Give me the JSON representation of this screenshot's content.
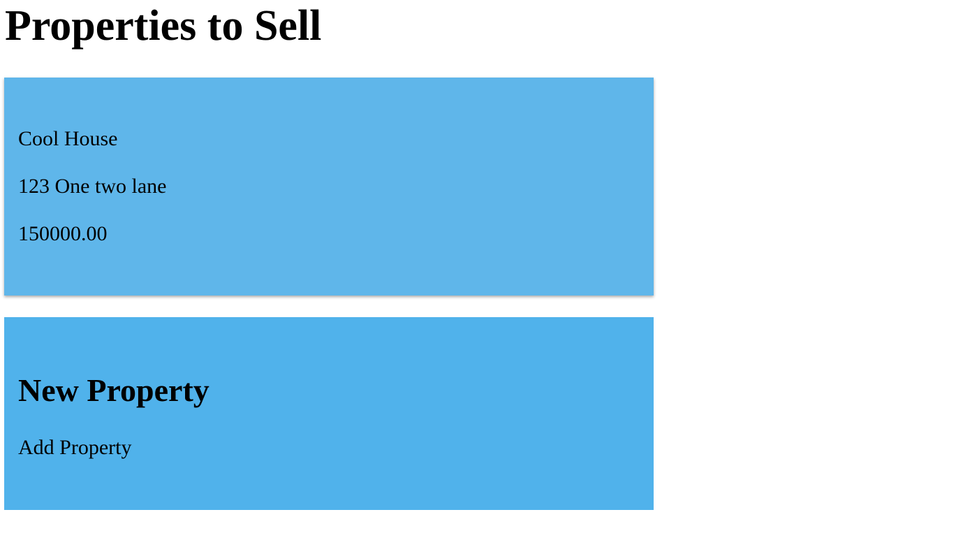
{
  "page": {
    "title": "Properties to Sell"
  },
  "properties": [
    {
      "name": "Cool House",
      "address": "123 One two lane",
      "price": "150000.00"
    }
  ],
  "new_property": {
    "heading": "New Property",
    "add_label": "Add Property"
  },
  "colors": {
    "property_card_bg": "#5fb6ea",
    "new_property_card_bg": "#50b2eb"
  }
}
